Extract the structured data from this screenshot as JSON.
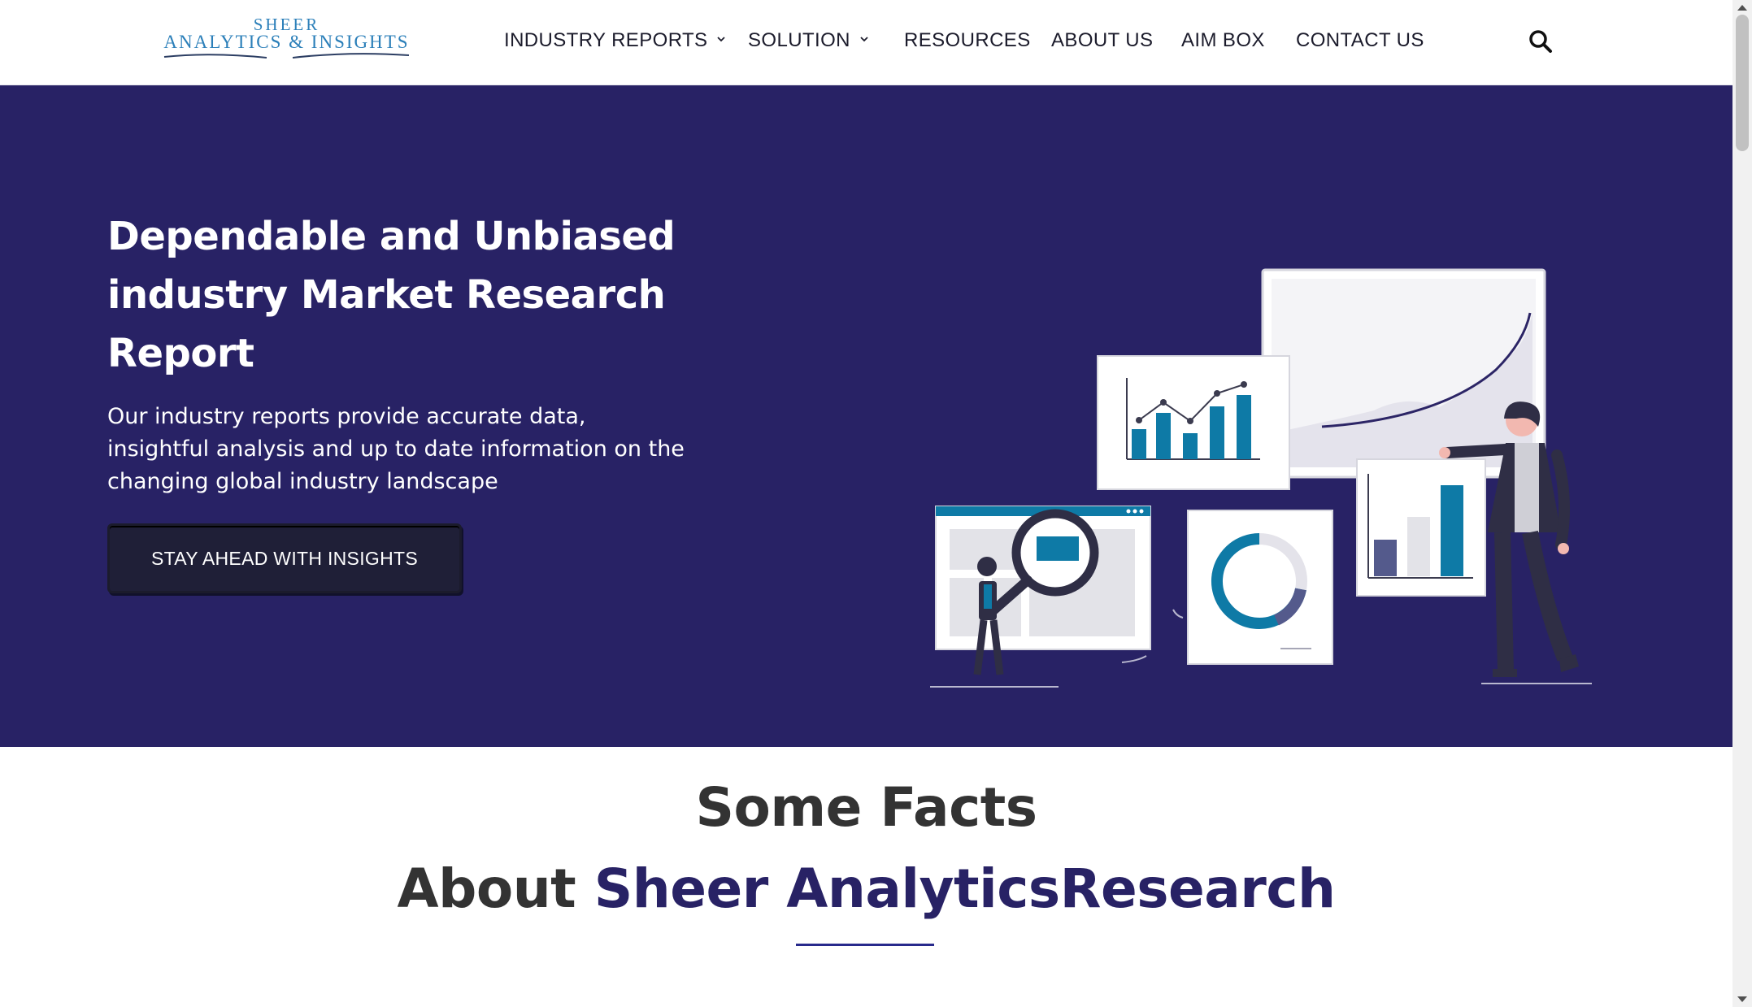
{
  "brand": {
    "logo_top": "SHEER",
    "logo_bottom": "ANALYTICS & INSIGHTS"
  },
  "nav": {
    "items": [
      {
        "label": "INDUSTRY REPORTS",
        "has_dropdown": true
      },
      {
        "label": "SOLUTION",
        "has_dropdown": true
      },
      {
        "label": "RESOURCES",
        "has_dropdown": false
      },
      {
        "label": "ABOUT US",
        "has_dropdown": false
      },
      {
        "label": "AIM BOX",
        "has_dropdown": false
      },
      {
        "label": "CONTACT US",
        "has_dropdown": false
      }
    ],
    "search_icon": "search-icon"
  },
  "hero": {
    "title": "Dependable and Unbiased industry Market Research Report",
    "description": "Our industry reports provide accurate data, insightful analysis and up to date information on the changing global industry landscape",
    "cta_label": "STAY AHEAD WITH INSIGHTS",
    "illustration": "analytics-dashboard-illustration"
  },
  "facts": {
    "title": "Some Facts",
    "subtitle_prefix": "About ",
    "subtitle_accent": "Sheer AnalyticsResearch"
  },
  "colors": {
    "hero_bg": "#282265",
    "accent": "#282265",
    "chart_teal": "#0e7aa6",
    "logo_blue": "#2b7fb9"
  }
}
